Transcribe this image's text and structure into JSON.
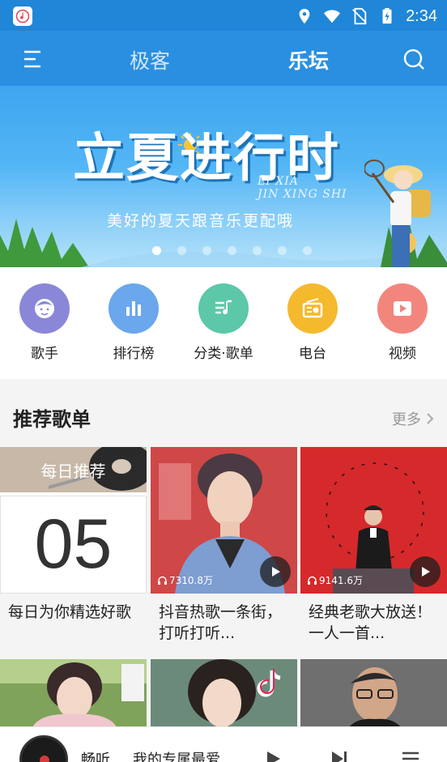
{
  "status_bar": {
    "app_icon": "music-note-icon",
    "icons": [
      "location-icon",
      "wifi-icon",
      "no-sim-icon",
      "battery-charging-icon"
    ],
    "time": "2:34"
  },
  "header": {
    "menu_icon": "menu-icon",
    "tabs": [
      {
        "label": "极客",
        "active": false
      },
      {
        "label": "乐坛",
        "active": true
      }
    ],
    "search_icon": "search-icon",
    "colors": {
      "bar": "#2a8fe0",
      "status": "#1f86d8"
    }
  },
  "banner": {
    "title": "立夏进行时",
    "english_line1": "LI XIA",
    "english_line2": "JIN XING SHI",
    "subtitle": "美好的夏天跟音乐更配哦",
    "dots_total": 7,
    "active_dot": 0
  },
  "categories": [
    {
      "label": "歌手",
      "icon": "singer-icon",
      "color": "#8a87d8"
    },
    {
      "label": "排行榜",
      "icon": "chart-bars-icon",
      "color": "#6aa7ec"
    },
    {
      "label": "分类·歌单",
      "icon": "playlist-icon",
      "color": "#5cc8a8"
    },
    {
      "label": "电台",
      "icon": "radio-icon",
      "color": "#f5b92e"
    },
    {
      "label": "视频",
      "icon": "video-icon",
      "color": "#f2867d"
    }
  ],
  "recommend": {
    "title": "推荐歌单",
    "more_label": "更多",
    "playlists": [
      {
        "daily_label": "每日推荐",
        "day": "05",
        "title": "每日为你精选好歌",
        "play_count": ""
      },
      {
        "title": "抖音热歌一条街，打听打听...",
        "play_count": "7310.8万"
      },
      {
        "title": "经典老歌大放送！一人一首...",
        "play_count": "9141.6万"
      }
    ]
  },
  "player": {
    "name": "畅听",
    "song": "我的专属最爱",
    "controls": [
      "play-icon",
      "next-icon",
      "queue-icon"
    ]
  }
}
